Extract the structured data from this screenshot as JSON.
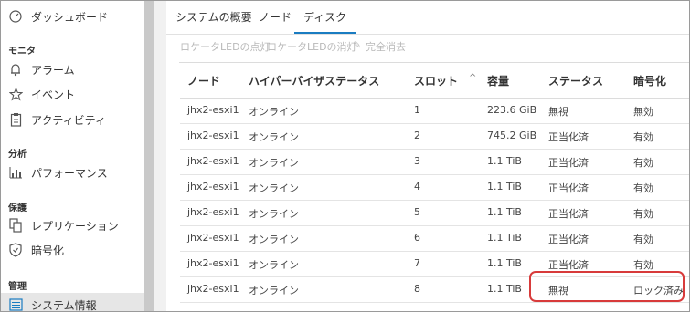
{
  "sidebar": {
    "items_top": [
      {
        "label": "ダッシュボード",
        "icon": "dashboard-gauge-icon"
      }
    ],
    "sections": [
      {
        "header": "モニタ",
        "items": [
          {
            "label": "アラーム",
            "icon": "bell-icon"
          },
          {
            "label": "イベント",
            "icon": "star-icon"
          },
          {
            "label": "アクティビティ",
            "icon": "clipboard-icon"
          }
        ]
      },
      {
        "header": "分析",
        "items": [
          {
            "label": "パフォーマンス",
            "icon": "bar-chart-icon"
          }
        ]
      },
      {
        "header": "保護",
        "items": [
          {
            "label": "レプリケーション",
            "icon": "copy-icon"
          },
          {
            "label": "暗号化",
            "icon": "shield-icon"
          }
        ]
      },
      {
        "header": "管理",
        "items": [
          {
            "label": "システム情報",
            "icon": "system-info-icon",
            "active": true
          }
        ]
      }
    ]
  },
  "tabs": [
    {
      "label": "システムの概要"
    },
    {
      "label": "ノード"
    },
    {
      "label": "ディスク",
      "active": true
    }
  ],
  "toolbar": {
    "led_on": "ロケータLEDの点灯",
    "led_off": "ロケータLEDの消灯",
    "wipe": "完全消去"
  },
  "table": {
    "columns": [
      "ノード",
      "ハイパーバイザステータス",
      "スロット",
      "容量",
      "ステータス",
      "暗号化"
    ],
    "sort_indicator": "^",
    "rows": [
      [
        "jhx2-esxi1",
        "オンライン",
        "1",
        "223.6 GiB",
        "無視",
        "無効"
      ],
      [
        "jhx2-esxi1",
        "オンライン",
        "2",
        "745.2 GiB",
        "正当化済",
        "有効"
      ],
      [
        "jhx2-esxi1",
        "オンライン",
        "3",
        "1.1 TiB",
        "正当化済",
        "有効"
      ],
      [
        "jhx2-esxi1",
        "オンライン",
        "4",
        "1.1 TiB",
        "正当化済",
        "有効"
      ],
      [
        "jhx2-esxi1",
        "オンライン",
        "5",
        "1.1 TiB",
        "正当化済",
        "有効"
      ],
      [
        "jhx2-esxi1",
        "オンライン",
        "6",
        "1.1 TiB",
        "正当化済",
        "有効"
      ],
      [
        "jhx2-esxi1",
        "オンライン",
        "7",
        "1.1 TiB",
        "正当化済",
        "有効"
      ],
      [
        "jhx2-esxi1",
        "オンライン",
        "8",
        "1.1 TiB",
        "無視",
        "ロック済み"
      ]
    ]
  },
  "colors": {
    "accent": "#1a7cc1",
    "highlight": "#d83b3b",
    "sidebar_active": "#e6e6e6",
    "disabled_text": "#b9b9b9"
  }
}
